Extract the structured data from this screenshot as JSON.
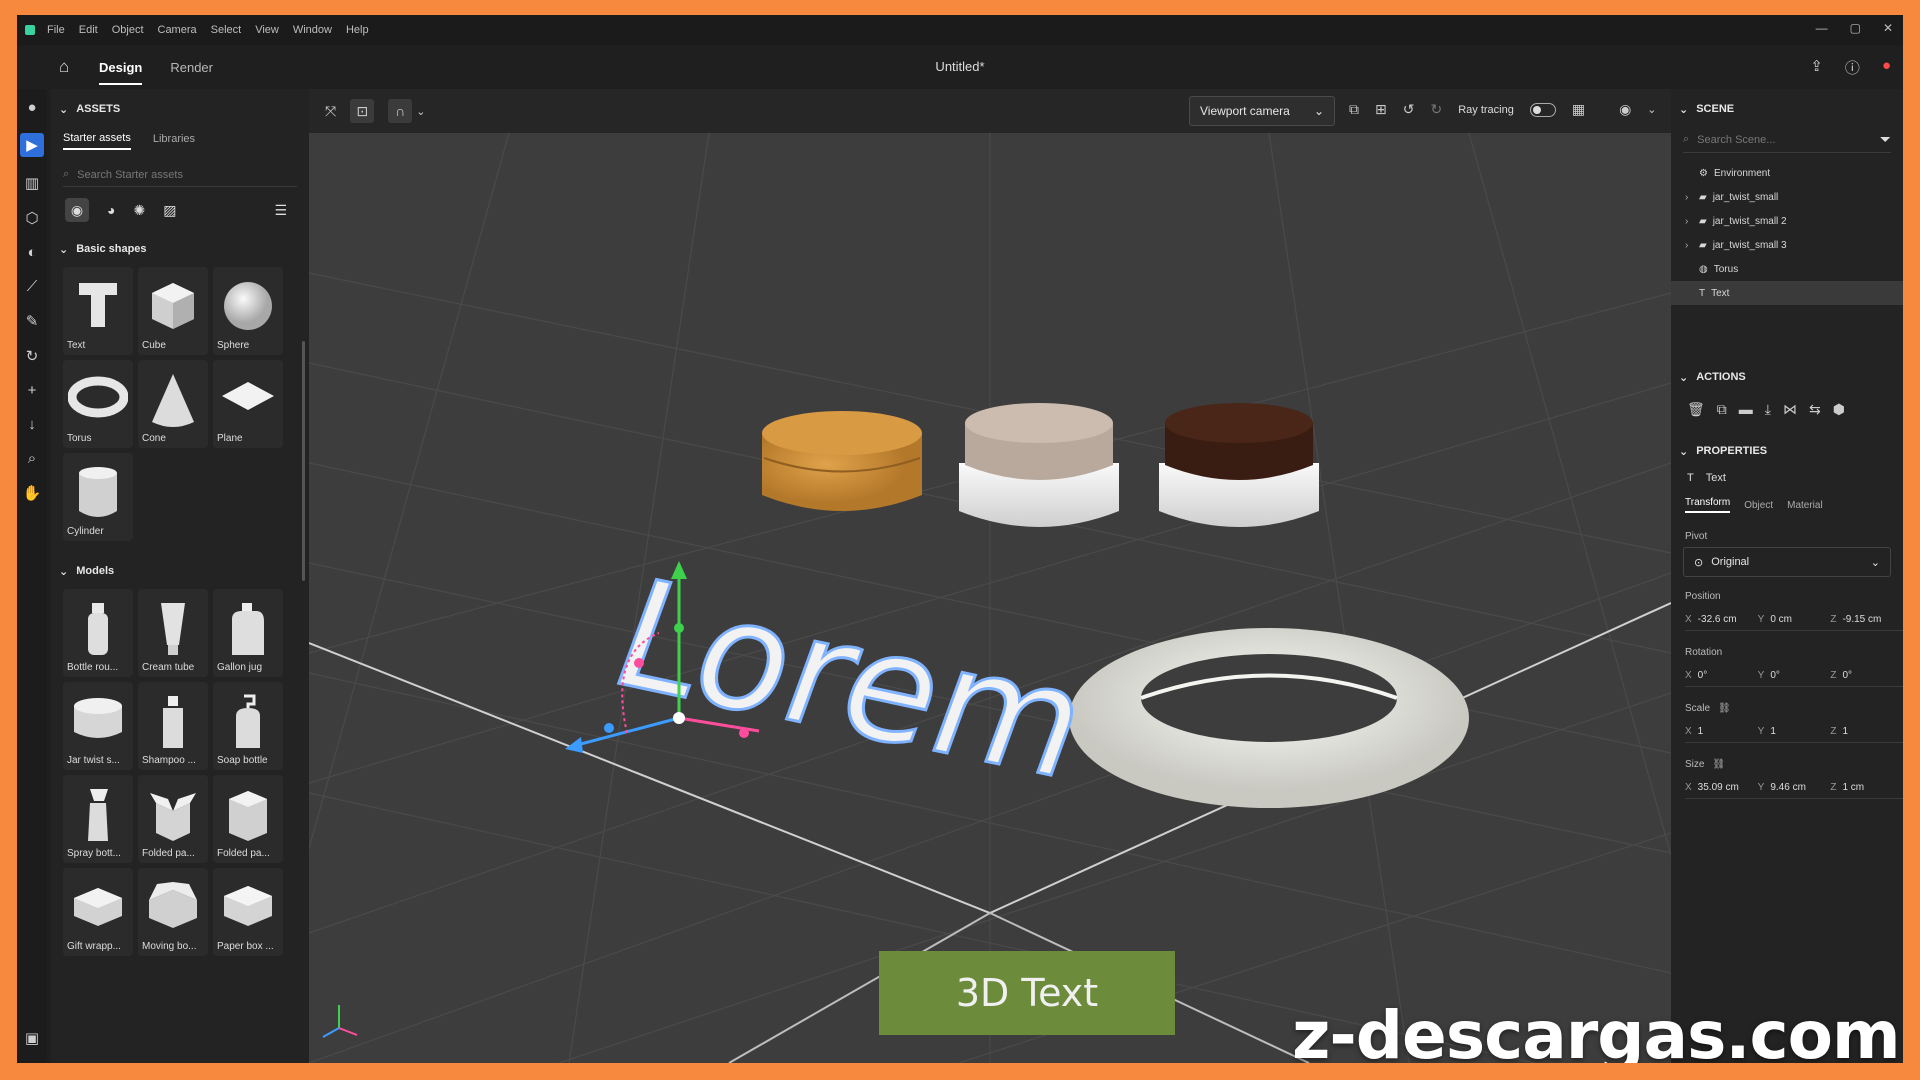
{
  "menu": [
    "File",
    "Edit",
    "Object",
    "Camera",
    "Select",
    "View",
    "Window",
    "Help"
  ],
  "header": {
    "tabs": [
      "Design",
      "Render"
    ],
    "active": "Design",
    "doc_title": "Untitled*"
  },
  "assets": {
    "title": "ASSETS",
    "tabs": [
      "Starter assets",
      "Libraries"
    ],
    "search_placeholder": "Search Starter assets",
    "basic_title": "Basic shapes",
    "basic": [
      "Text",
      "Cube",
      "Sphere",
      "Torus",
      "Cone",
      "Plane",
      "Cylinder"
    ],
    "models_title": "Models",
    "models": [
      "Bottle rou...",
      "Cream tube",
      "Gallon jug",
      "Jar twist s...",
      "Shampoo ...",
      "Soap bottle",
      "Spray bott...",
      "Folded pa...",
      "Folded pa...",
      "Gift wrapp...",
      "Moving bo...",
      "Paper box ..."
    ]
  },
  "viewport": {
    "camera": "Viewport camera",
    "ray_tracing": "Ray tracing",
    "scene_text": "Lorem",
    "caption": "3D Text"
  },
  "scene": {
    "title": "SCENE",
    "search_placeholder": "Search Scene...",
    "items": [
      "Environment",
      "jar_twist_small",
      "jar_twist_small 2",
      "jar_twist_small 3",
      "Torus",
      "Text"
    ],
    "selected": "Text"
  },
  "actions_title": "ACTIONS",
  "properties": {
    "title": "PROPERTIES",
    "object": "Text",
    "tabs": [
      "Transform",
      "Object",
      "Material"
    ],
    "pivot_label": "Pivot",
    "pivot": "Original",
    "position_label": "Position",
    "position": {
      "x": "-32.6 cm",
      "y": "0 cm",
      "z": "-9.15 cm"
    },
    "rotation_label": "Rotation",
    "rotation": {
      "x": "0°",
      "y": "0°",
      "z": "0°"
    },
    "scale_label": "Scale",
    "scale": {
      "x": "1",
      "y": "1",
      "z": "1"
    },
    "size_label": "Size",
    "size": {
      "x": "35.09 cm",
      "y": "9.46 cm",
      "z": "1 cm"
    }
  },
  "watermark": "z-descargas.com"
}
